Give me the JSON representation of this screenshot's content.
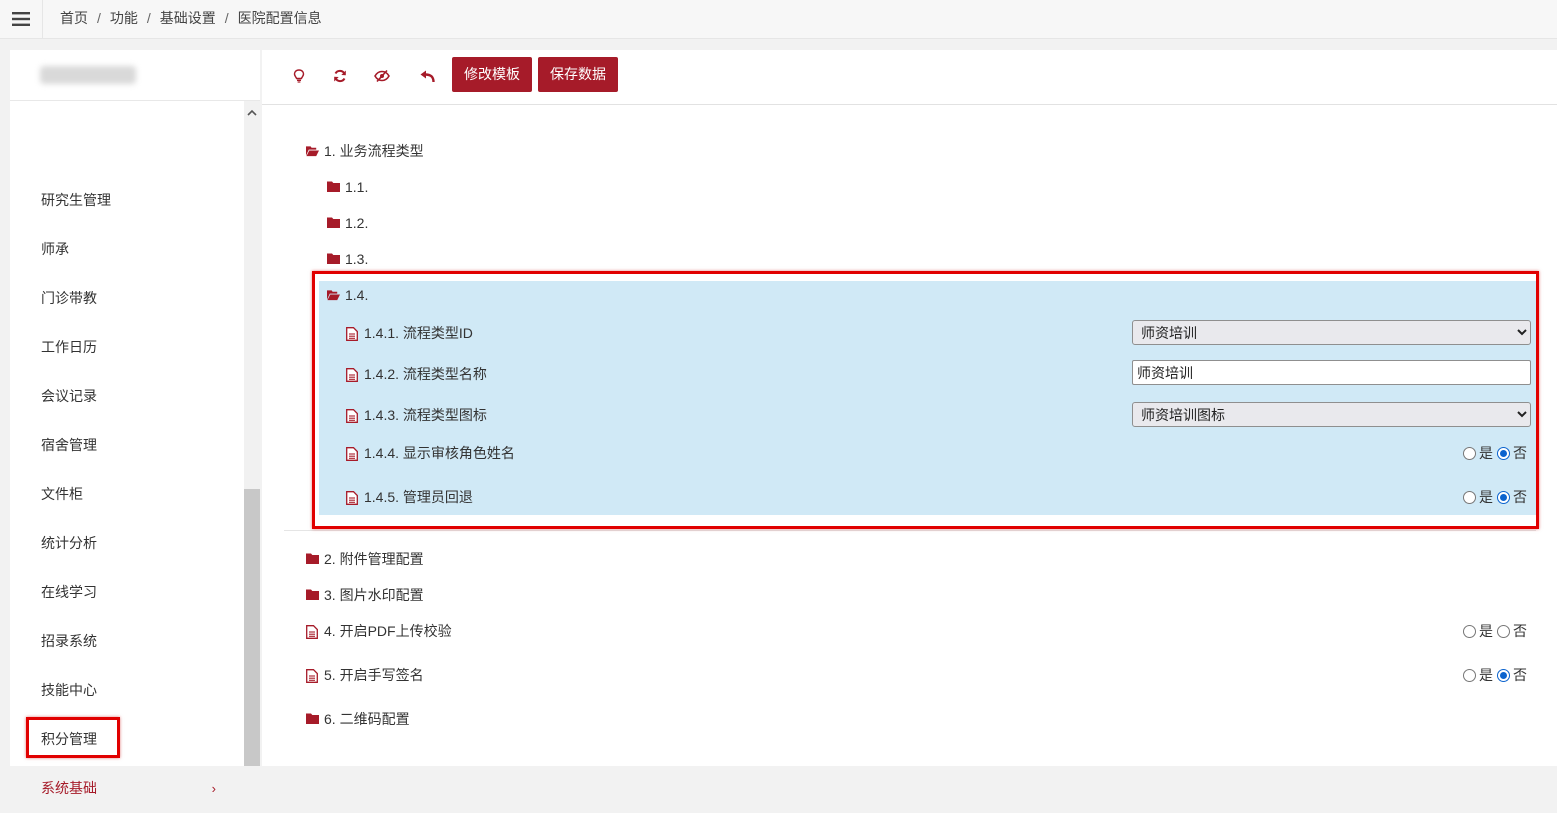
{
  "breadcrumb": {
    "home": "首页",
    "level1": "功能",
    "level2": "基础设置",
    "current": "医院配置信息",
    "separator": "/"
  },
  "sidebar": {
    "items": [
      {
        "label": "研究生管理"
      },
      {
        "label": "师承"
      },
      {
        "label": "门诊带教"
      },
      {
        "label": "工作日历"
      },
      {
        "label": "会议记录"
      },
      {
        "label": "宿舍管理"
      },
      {
        "label": "文件柜"
      },
      {
        "label": "统计分析"
      },
      {
        "label": "在线学习"
      },
      {
        "label": "招录系统"
      },
      {
        "label": "技能中心"
      },
      {
        "label": "积分管理"
      },
      {
        "label": "系统基础",
        "active": true,
        "chevron": "›"
      }
    ]
  },
  "toolbar": {
    "icons": [
      "lightbulb-icon",
      "refresh-icon",
      "eye-slash-icon",
      "undo-icon"
    ],
    "edit_template_label": "修改模板",
    "save_data_label": "保存数据"
  },
  "tree": {
    "node1": {
      "label": "1. 业务流程类型",
      "expanded": true
    },
    "node1_1": {
      "label": "1.1."
    },
    "node1_2": {
      "label": "1.2."
    },
    "node1_3": {
      "label": "1.3."
    },
    "node1_4": {
      "label": "1.4.",
      "expanded": true,
      "selected": true
    },
    "node1_4_1": {
      "label": "1.4.1. 流程类型ID",
      "value": "师资培训"
    },
    "node1_4_2": {
      "label": "1.4.2. 流程类型名称",
      "value": "师资培训"
    },
    "node1_4_3": {
      "label": "1.4.3. 流程类型图标",
      "value": "师资培训图标"
    },
    "node1_4_4": {
      "label": "1.4.4. 显示审核角色姓名",
      "selected": "否"
    },
    "node1_4_5": {
      "label": "1.4.5. 管理员回退",
      "selected": "否"
    },
    "node2": {
      "label": "2. 附件管理配置"
    },
    "node3": {
      "label": "3. 图片水印配置"
    },
    "node4": {
      "label": "4. 开启PDF上传校验",
      "selected": ""
    },
    "node5": {
      "label": "5. 开启手写签名",
      "selected": "否"
    },
    "node6": {
      "label": "6. 二维码配置"
    }
  },
  "radio": {
    "yes": "是",
    "no": "否"
  },
  "colors": {
    "accent": "#a61b29",
    "selected_row": "#d0e9f6",
    "annotation_red": "#e10000",
    "radio_blue": "#0b63ce"
  }
}
